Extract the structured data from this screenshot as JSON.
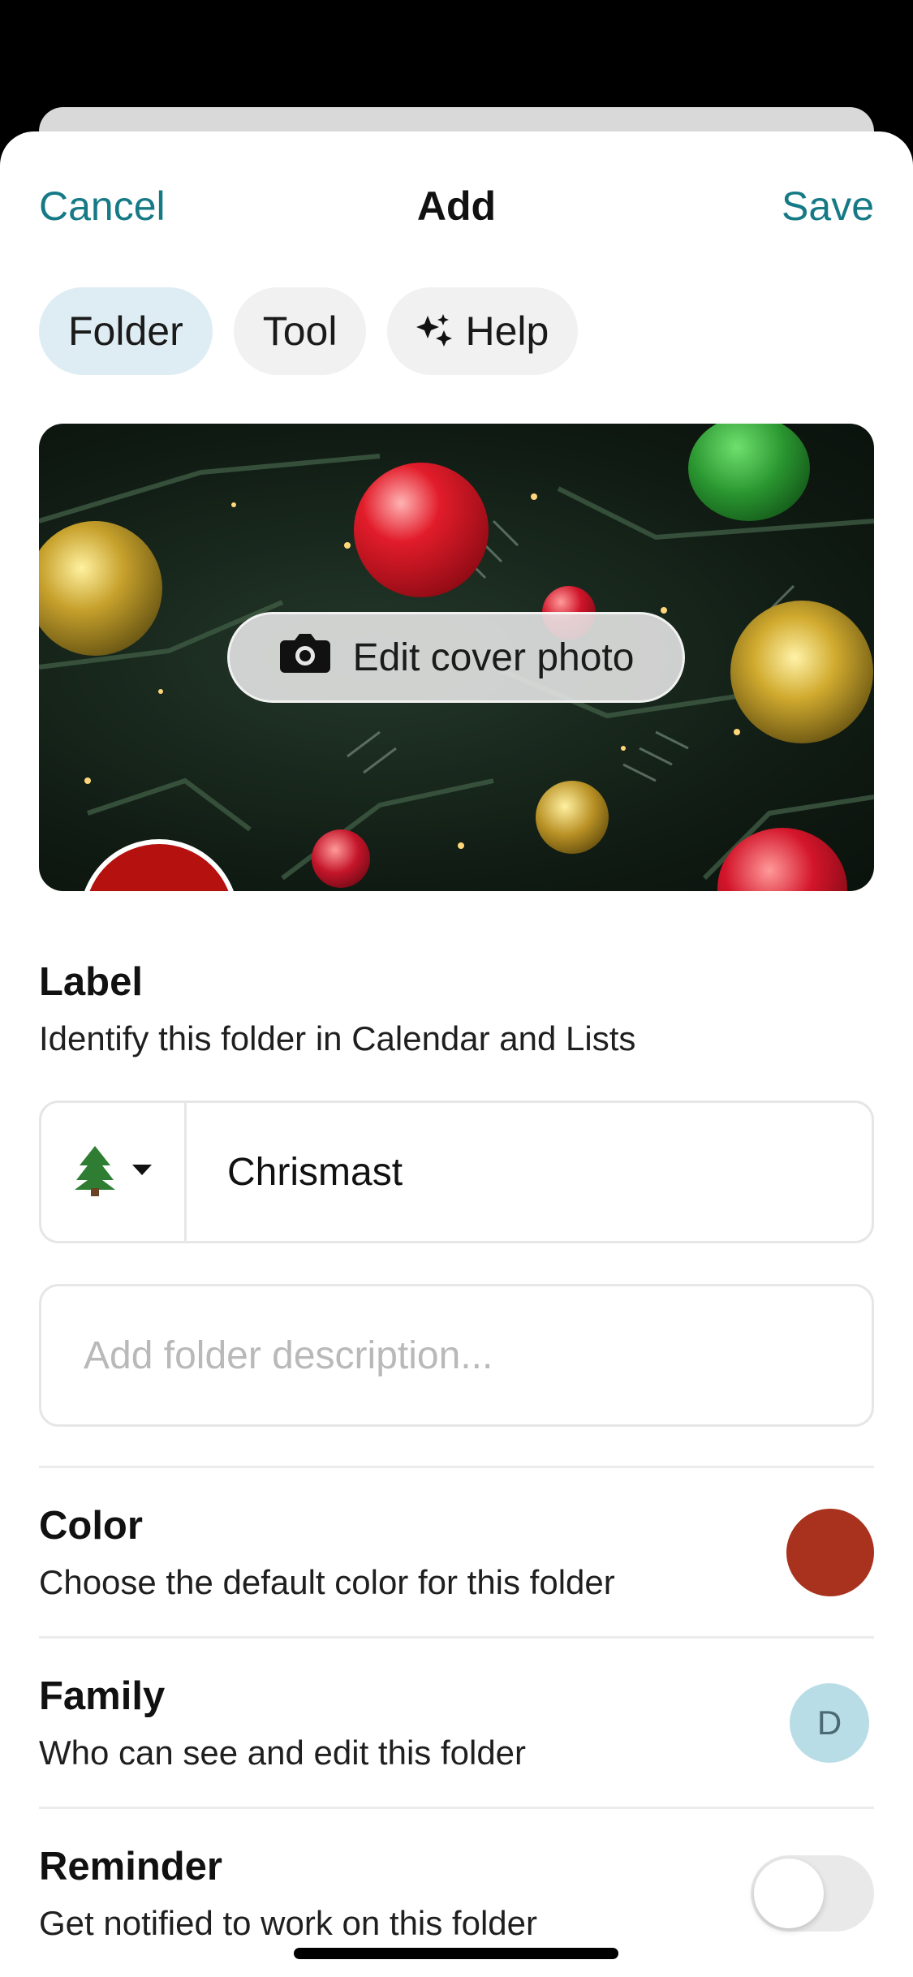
{
  "header": {
    "cancel_label": "Cancel",
    "title": "Add",
    "save_label": "Save"
  },
  "tabs": [
    {
      "label": "Folder",
      "active": true
    },
    {
      "label": "Tool",
      "active": false
    },
    {
      "label": "Help",
      "active": false,
      "icon": "sparkles-icon"
    }
  ],
  "cover": {
    "edit_label": "Edit cover photo",
    "icon": "camera-icon"
  },
  "label_section": {
    "title": "Label",
    "subtitle": "Identify this folder in Calendar and Lists",
    "emoji": "🌲",
    "value": "Chrismast",
    "description_placeholder": "Add folder description..."
  },
  "color_section": {
    "title": "Color",
    "subtitle": "Choose the default color for this folder",
    "color": "#a8321d"
  },
  "family_section": {
    "title": "Family",
    "subtitle": "Who can see and edit this folder",
    "member_initial": "D"
  },
  "reminder_section": {
    "title": "Reminder",
    "subtitle": "Get notified to work on this folder",
    "enabled": false
  }
}
